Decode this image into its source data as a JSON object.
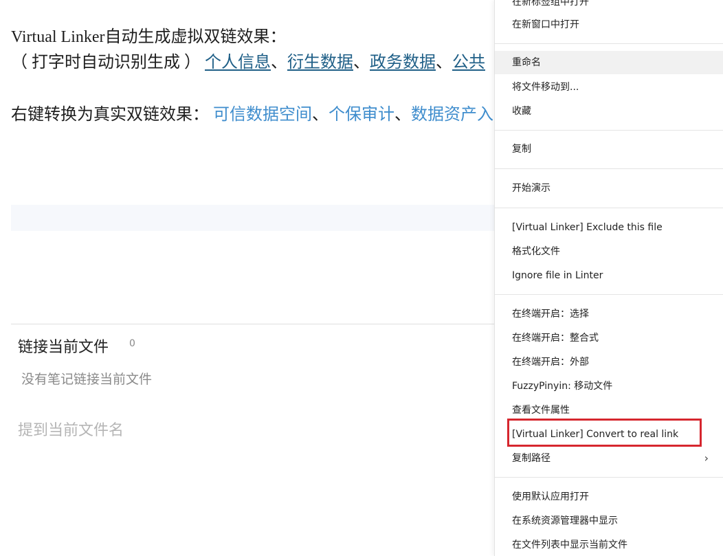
{
  "editor": {
    "line1": "Virtual Linker自动生成虚拟双链效果：",
    "line2_prefix": "（ 打字时自动识别生成 ）",
    "virtual_links": [
      "个人信息",
      "衍生数据",
      "政务数据",
      "公共"
    ],
    "separator": "、",
    "line3_prefix": "右键转换为真实双链效果：",
    "real_links": [
      "可信数据空间",
      "个保审计",
      "数据资产入"
    ]
  },
  "backlinks": {
    "title": "链接当前文件",
    "count": "0",
    "empty_text": "没有笔记链接当前文件"
  },
  "mentions": {
    "title": "提到当前文件名"
  },
  "menu": {
    "items": [
      "在新标签组中打开",
      "在新窗口中打开",
      "重命名",
      "将文件移动到...",
      "收藏",
      "复制",
      "开始演示",
      "[Virtual Linker] Exclude this file",
      "格式化文件",
      "Ignore file in Linter",
      "在终端开启：选择",
      "在终端开启：整合式",
      "在终端开启：外部",
      "FuzzyPinyin: 移动文件",
      "查看文件属性",
      "[Virtual Linker] Convert to real link",
      "复制路径",
      "使用默认应用打开",
      "在系统资源管理器中显示",
      "在文件列表中显示当前文件"
    ],
    "submenu_indicator": "›",
    "highlight_color": "#d6262e"
  }
}
